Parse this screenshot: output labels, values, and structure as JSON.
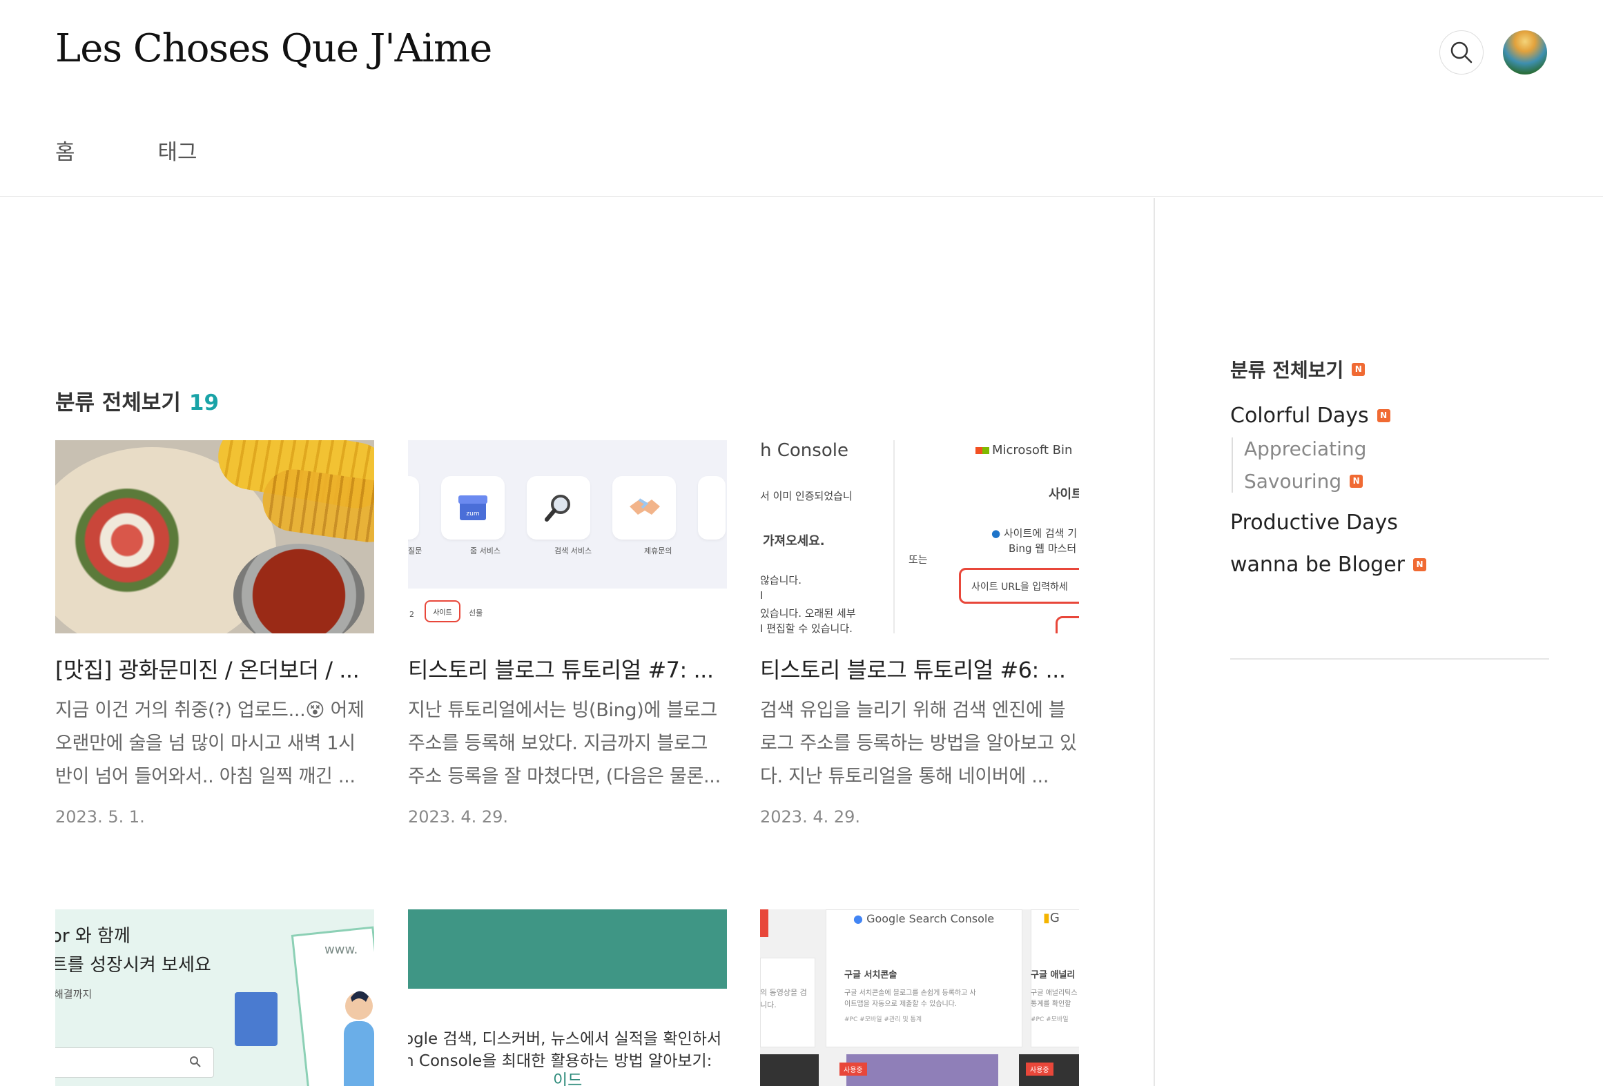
{
  "header": {
    "blog_title": "Les Choses Que J'Aime",
    "search_icon": "search-icon",
    "avatar": "profile-avatar"
  },
  "nav": {
    "items": [
      {
        "label": "홈"
      },
      {
        "label": "태그"
      }
    ]
  },
  "section": {
    "title": "분류 전체보기",
    "count": "19"
  },
  "posts": [
    {
      "title": "[맛집] 광화문미진 / 온더보더 / ...",
      "excerpt": "지금 이건 거의 취중(?) 업로드...😵 어제 오랜만에 술을 넘 많이 마시고 새벽 1시 반이 넘어 들어와서.. 아침 일찍 깨긴 ...",
      "date": "2023. 5. 1."
    },
    {
      "title": "티스토리 블로그 튜토리얼 #7: ...",
      "excerpt": "지난 튜토리얼에서는 빙(Bing)에 블로그 주소를 등록해 보았다. 지금까지 블로그 주소 등록을 잘 마쳤다면, (다음은 물론...",
      "date": "2023. 4. 29."
    },
    {
      "title": "티스토리 블로그 튜토리얼 #6: ...",
      "excerpt": "검색 유입을 늘리기 위해 검색 엔진에 블로그 주소를 등록하는 방법을 알아보고 있다. 지난 튜토리얼을 통해 네이버에 ...",
      "date": "2023. 4. 29."
    }
  ],
  "thumbs": {
    "t2": {
      "labels": [
        "줌 서비스",
        "검색 서비스",
        "제휴문의"
      ],
      "pill": "사이트",
      "pill_next": "선물",
      "zum": "zum",
      "left_label": "질문",
      "left_num": "2"
    },
    "t3": {
      "title": "h Console",
      "ms": "Microsoft Bin",
      "l1": "서 이미 인증되었습니",
      "l2": "가져오세요.",
      "l3": "않습니다.",
      "l4": "I",
      "l5": "있습니다. 오래된 세부",
      "l6": "I 편집할 수 있습니다.",
      "or": "또는",
      "r1": "사이트",
      "r2": "사이트에 검색 기",
      "r3": "Bing 웹 마스터",
      "url": "사이트 URL을 입력하세"
    },
    "t4": {
      "l1": "or 와 함께",
      "l2": "트를 성장시켜 보세요",
      "l3": "해결까지",
      "www": "www."
    },
    "t5": {
      "l1": "ogle 검색, 디스커버, 뉴스에서 실적을 확인하서",
      "l2": "n Console을 최대한 활용하는 방법 알아보기:",
      "l3": "이드"
    },
    "t6": {
      "brand": "Google Search Console",
      "g": "G",
      "c1_title": "구글 서치콘솔",
      "c1_desc1": "구글 서치콘솔에 블로그를 손쉽게 등록하고 사",
      "c1_desc2": "이트맵을 자동으로 제출할 수 있습니다.",
      "c1_tags": "#PC  #모바일  #관리 및 통계",
      "c2_title": "구글 애널리",
      "c2_desc1": "구글 애널리틱스",
      "c2_desc2": "통계를 확인할",
      "c2_tags": "#PC  #모바일",
      "left1": "의 동영상을 검",
      "left2": "니다.",
      "in_use": "사용중",
      "in_use2": "사용중"
    }
  },
  "sidebar": {
    "root": "분류 전체보기",
    "categories": [
      {
        "label": "Colorful Days",
        "new": true
      },
      {
        "label": "Productive Days",
        "new": false
      },
      {
        "label": "wanna be Bloger",
        "new": true
      }
    ],
    "subcategories": [
      {
        "label": "Appreciating",
        "new": false
      },
      {
        "label": "Savouring",
        "new": true
      }
    ],
    "badge_text": "N"
  },
  "colors": {
    "accent_count": "#19a3a7",
    "new_badge": "#f06a33",
    "divider": "#e6e6e6"
  }
}
